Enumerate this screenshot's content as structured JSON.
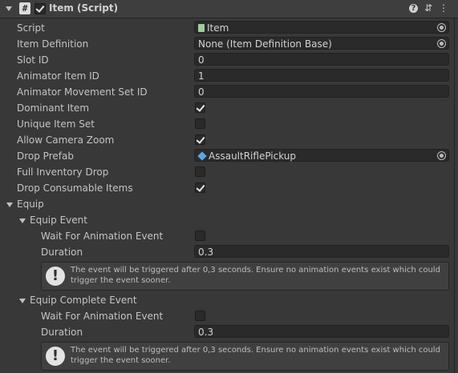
{
  "header": {
    "title": "Item (Script)",
    "enabled": true,
    "icons": [
      "foldout-arrow-icon",
      "script-icon",
      "help-icon",
      "preset-icon",
      "more-menu-icon"
    ]
  },
  "properties": [
    {
      "label": "Script",
      "type": "object",
      "value": "Item",
      "icon": "script-file-icon"
    },
    {
      "label": "Item Definition",
      "type": "object",
      "value": "None (Item Definition Base)"
    },
    {
      "label": "Slot ID",
      "type": "text",
      "value": "0"
    },
    {
      "label": "Animator Item ID",
      "type": "text",
      "value": "1"
    },
    {
      "label": "Animator Movement Set ID",
      "type": "text",
      "value": "0"
    },
    {
      "label": "Dominant Item",
      "type": "checkbox",
      "checked": true
    },
    {
      "label": "Unique Item Set",
      "type": "checkbox",
      "checked": false
    },
    {
      "label": "Allow Camera Zoom",
      "type": "checkbox",
      "checked": true
    },
    {
      "label": "Drop Prefab",
      "type": "object",
      "value": "AssaultRiflePickup",
      "icon": "prefab-icon"
    },
    {
      "label": "Full Inventory Drop",
      "type": "checkbox",
      "checked": false
    },
    {
      "label": "Drop Consumable Items",
      "type": "checkbox",
      "checked": true
    }
  ],
  "equip": {
    "label": "Equip",
    "equip_event": {
      "label": "Equip Event",
      "wait_label": "Wait For Animation Event",
      "wait_checked": false,
      "duration_label": "Duration",
      "duration_value": "0.3",
      "help_text": "The event will be triggered after 0,3 seconds. Ensure no animation events exist which could trigger the event sooner."
    },
    "equip_complete_event": {
      "label": "Equip Complete Event",
      "wait_label": "Wait For Animation Event",
      "wait_checked": false,
      "duration_label": "Duration",
      "duration_value": "0.3",
      "help_text": "The event will be triggered after 0,3 seconds. Ensure no animation events exist which could trigger the event sooner."
    }
  }
}
